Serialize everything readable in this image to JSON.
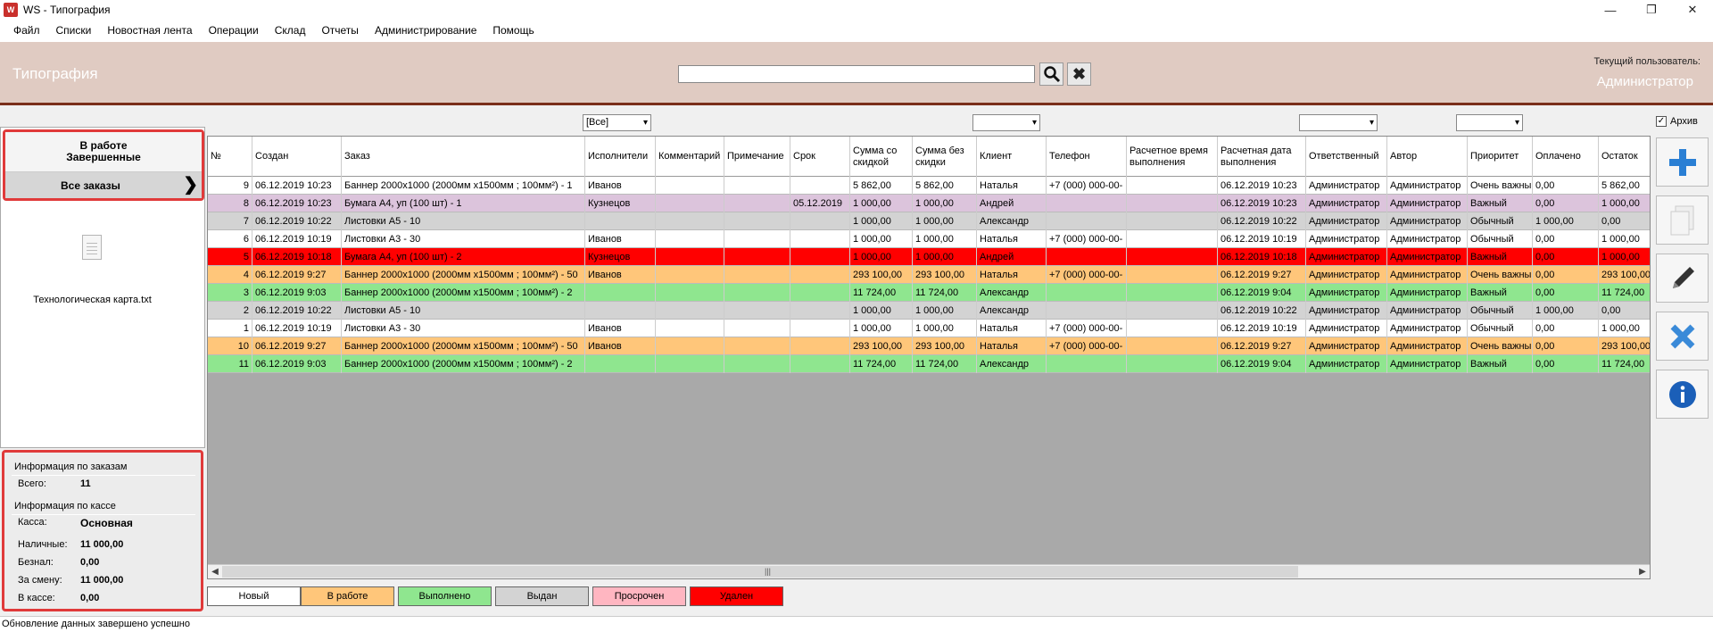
{
  "window": {
    "title": "WS - Типография",
    "icon_text": "W"
  },
  "menu": [
    "Файл",
    "Списки",
    "Новостная лента",
    "Операции",
    "Склад",
    "Отчеты",
    "Администрирование",
    "Помощь"
  ],
  "header": {
    "brand": "Типография",
    "current_user_label": "Текущий пользователь:",
    "current_user": "Администратор",
    "search_value": ""
  },
  "left": {
    "status_in_work": "В работе",
    "status_done": "Завершенные",
    "all_orders": "Все заказы",
    "file_name": "Технологическая карта.txt"
  },
  "info": {
    "orders_title": "Информация по заказам",
    "total_label": "Всего:",
    "total_value": "11",
    "cash_title": "Информация по кассе",
    "cashbox_label": "Касса:",
    "cashbox_value": "Основная",
    "cash_label": "Наличные:",
    "cash_value": "11 000,00",
    "noncash_label": "Безнал:",
    "noncash_value": "0,00",
    "shift_label": "За смену:",
    "shift_value": "11 000,00",
    "inbox_label": "В кассе:",
    "inbox_value": "0,00"
  },
  "filters": {
    "executors": "[Все]",
    "client": "",
    "responsible": "",
    "priority": ""
  },
  "archive_label": "Архив",
  "columns": [
    "№",
    "Создан",
    "Заказ",
    "Исполнители",
    "Комментарий",
    "Примечание",
    "Срок",
    "Сумма со скидкой",
    "Сумма без скидки",
    "Клиент",
    "Телефон",
    "Расчетное время выполнения",
    "Расчетная дата выполнения",
    "Ответственный",
    "Автор",
    "Приоритет",
    "Оплачено",
    "Остаток"
  ],
  "rows": [
    {
      "status": "new",
      "cells": [
        "9",
        "06.12.2019 10:23",
        "Баннер 2000x1000 (2000мм x1500мм ; 100мм²) - 1",
        "Иванов",
        "",
        "",
        "",
        "5 862,00",
        "5 862,00",
        "Наталья",
        "+7 (000) 000-00-",
        "",
        "06.12.2019 10:23",
        "Администратор",
        "Администратор",
        "Очень важны",
        "0,00",
        "5 862,00"
      ]
    },
    {
      "status": "overdue",
      "cells": [
        "8",
        "06.12.2019 10:23",
        "Бумага А4, уп (100 шт) - 1",
        "Кузнецов",
        "",
        "",
        "05.12.2019",
        "1 000,00",
        "1 000,00",
        "Андрей",
        "",
        "",
        "06.12.2019 10:23",
        "Администратор",
        "Администратор",
        "Важный",
        "0,00",
        "1 000,00"
      ]
    },
    {
      "status": "issued",
      "cells": [
        "7",
        "06.12.2019 10:22",
        "Листовки А5 - 10",
        "",
        "",
        "",
        "",
        "1 000,00",
        "1 000,00",
        "Александр",
        "",
        "",
        "06.12.2019 10:22",
        "Администратор",
        "Администратор",
        "Обычный",
        "1 000,00",
        "0,00"
      ]
    },
    {
      "status": "new",
      "cells": [
        "6",
        "06.12.2019 10:19",
        "Листовки А3 - 30",
        "Иванов",
        "",
        "",
        "",
        "1 000,00",
        "1 000,00",
        "Наталья",
        "+7 (000) 000-00-",
        "",
        "06.12.2019 10:19",
        "Администратор",
        "Администратор",
        "Обычный",
        "0,00",
        "1 000,00"
      ]
    },
    {
      "status": "deleted",
      "cells": [
        "5",
        "06.12.2019 10:18",
        "Бумага А4, уп (100 шт) - 2",
        "Кузнецов",
        "",
        "",
        "",
        "1 000,00",
        "1 000,00",
        "Андрей",
        "",
        "",
        "06.12.2019 10:18",
        "Администратор",
        "Администратор",
        "Важный",
        "0,00",
        "1 000,00"
      ]
    },
    {
      "status": "inwork",
      "cells": [
        "4",
        "06.12.2019 9:27",
        "Баннер 2000x1000 (2000мм x1500мм ; 100мм²) - 50",
        "Иванов",
        "",
        "",
        "",
        "293 100,00",
        "293 100,00",
        "Наталья",
        "+7 (000) 000-00-",
        "",
        "06.12.2019 9:27",
        "Администратор",
        "Администратор",
        "Очень важны",
        "0,00",
        "293 100,00"
      ]
    },
    {
      "status": "done",
      "cells": [
        "3",
        "06.12.2019 9:03",
        "Баннер 2000x1000 (2000мм x1500мм ; 100мм²) - 2",
        "",
        "",
        "",
        "",
        "11 724,00",
        "11 724,00",
        "Александр",
        "",
        "",
        "06.12.2019 9:04",
        "Администратор",
        "Администратор",
        "Важный",
        "0,00",
        "11 724,00"
      ]
    },
    {
      "status": "issued",
      "cells": [
        "2",
        "06.12.2019 10:22",
        "Листовки А5 - 10",
        "",
        "",
        "",
        "",
        "1 000,00",
        "1 000,00",
        "Александр",
        "",
        "",
        "06.12.2019 10:22",
        "Администратор",
        "Администратор",
        "Обычный",
        "1 000,00",
        "0,00"
      ]
    },
    {
      "status": "new",
      "cells": [
        "1",
        "06.12.2019 10:19",
        "Листовки А3 - 30",
        "Иванов",
        "",
        "",
        "",
        "1 000,00",
        "1 000,00",
        "Наталья",
        "+7 (000) 000-00-",
        "",
        "06.12.2019 10:19",
        "Администратор",
        "Администратор",
        "Обычный",
        "0,00",
        "1 000,00"
      ]
    },
    {
      "status": "inwork",
      "cells": [
        "10",
        "06.12.2019 9:27",
        "Баннер 2000x1000 (2000мм x1500мм ; 100мм²) - 50",
        "Иванов",
        "",
        "",
        "",
        "293 100,00",
        "293 100,00",
        "Наталья",
        "+7 (000) 000-00-",
        "",
        "06.12.2019 9:27",
        "Администратор",
        "Администратор",
        "Очень важны",
        "0,00",
        "293 100,00"
      ]
    },
    {
      "status": "done",
      "cells": [
        "11",
        "06.12.2019 9:03",
        "Баннер 2000x1000 (2000мм x1500мм ; 100мм²) - 2",
        "",
        "",
        "",
        "",
        "11 724,00",
        "11 724,00",
        "Александр",
        "",
        "",
        "06.12.2019 9:04",
        "Администратор",
        "Администратор",
        "Важный",
        "0,00",
        "11 724,00"
      ]
    }
  ],
  "status_colors": {
    "new": "#ffffff",
    "inwork": "#ffc67a",
    "done": "#8fe68f",
    "issued": "#d3d3d3",
    "overdue": "#dcc4dc",
    "deleted": "#ff0000",
    "overdue_legend": "#ffb6c1"
  },
  "legend": [
    {
      "label": "Новый",
      "color": "#ffffff"
    },
    {
      "label": "В работе",
      "color": "#ffc67a"
    },
    {
      "label": "Выполнено",
      "color": "#8fe68f"
    },
    {
      "label": "Выдан",
      "color": "#d3d3d3"
    },
    {
      "label": "Просрочен",
      "color": "#ffb6c1"
    },
    {
      "label": "Удален",
      "color": "#ff0000"
    }
  ],
  "toolbar_icons": [
    "add-icon",
    "copy-icon",
    "edit-icon",
    "delete-icon",
    "info-icon"
  ],
  "status_bar": "Обновление данных завершено успешно"
}
